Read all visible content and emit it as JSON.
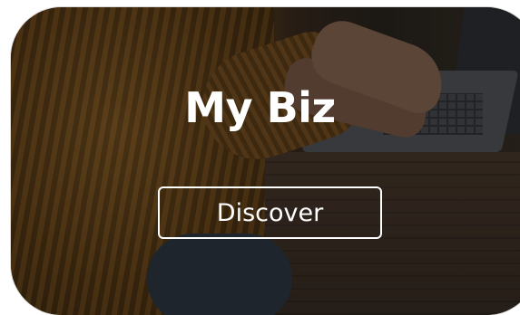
{
  "card": {
    "title": "My Biz",
    "button_label": "Discover"
  },
  "colors": {
    "text": "#ffffff",
    "overlay": "#000000"
  }
}
